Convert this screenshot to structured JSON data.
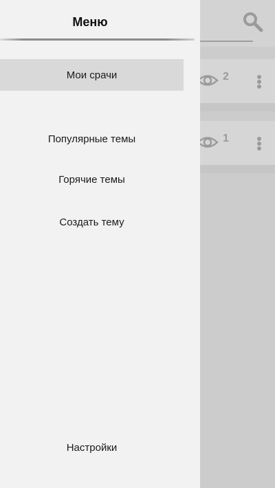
{
  "drawer": {
    "title": "Меню",
    "items": [
      {
        "label": "Мои срачи",
        "active": true
      },
      {
        "label": "Популярные темы"
      },
      {
        "label": "Горячие темы"
      },
      {
        "label": "Создать тему"
      },
      {
        "label": "Настройки"
      }
    ]
  },
  "background": {
    "search_icon": "search-icon",
    "threads": [
      {
        "views": "2"
      },
      {
        "views": "1"
      }
    ]
  },
  "colors": {
    "drawer_bg": "#f2f2f2",
    "active_item_bg": "#d9d9d9",
    "scrim": "#cccccc",
    "icon_gray": "#9a9a9a"
  }
}
